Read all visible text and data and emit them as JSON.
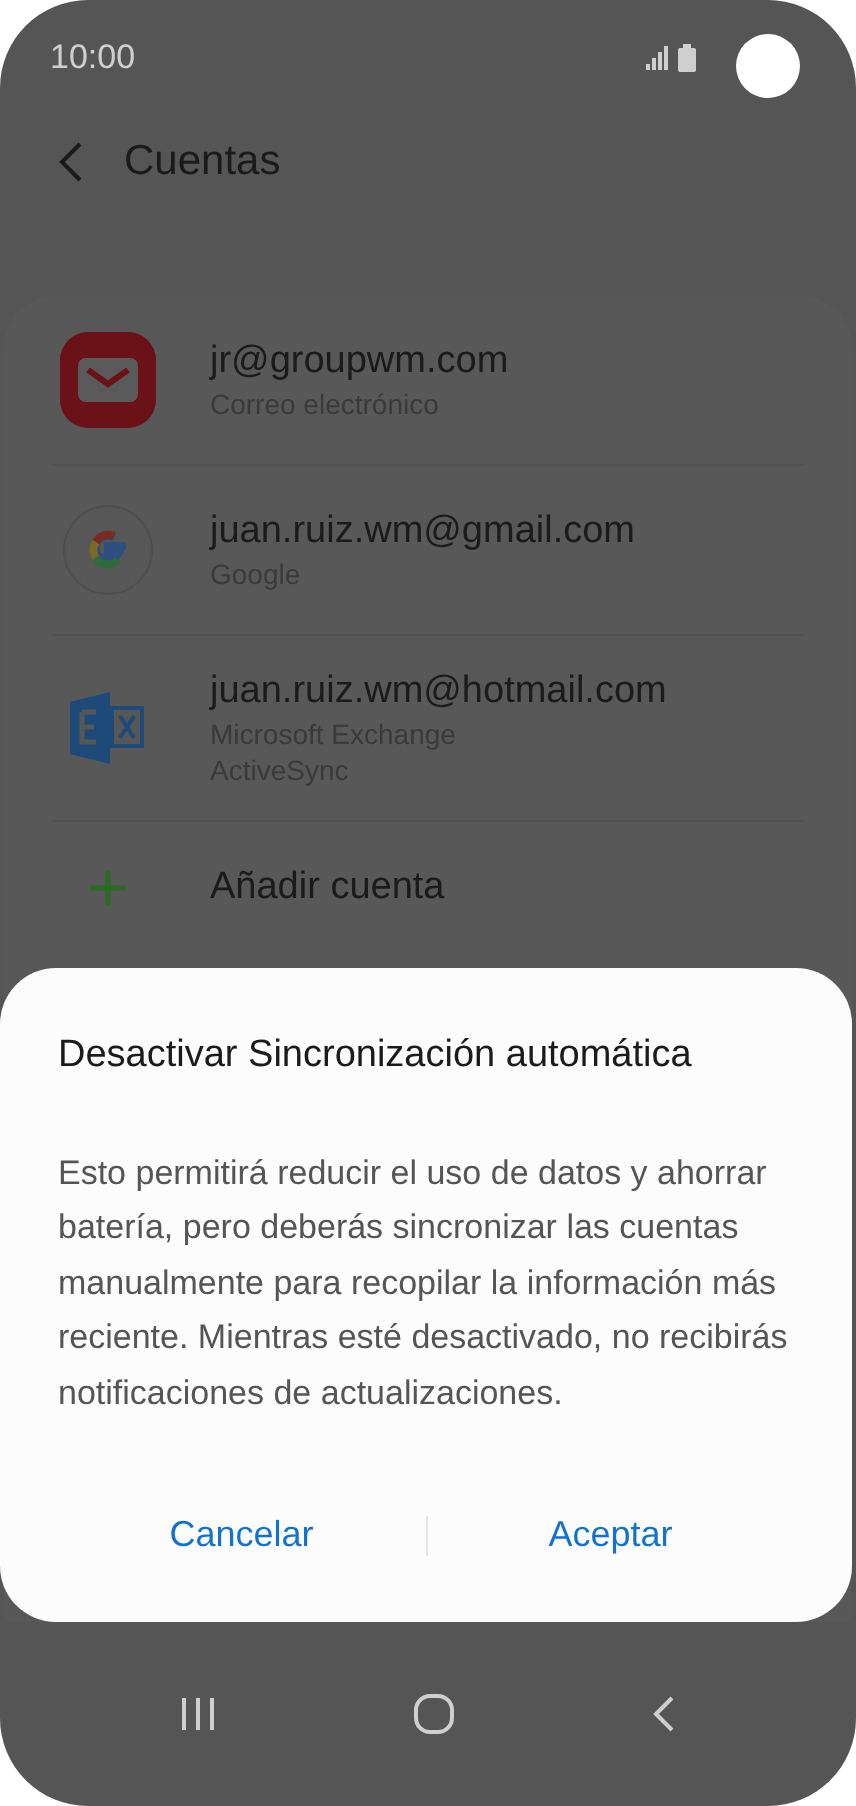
{
  "status_bar": {
    "time": "10:00"
  },
  "header": {
    "title": "Cuentas"
  },
  "accounts": [
    {
      "kind": "mail",
      "name": "jr@groupwm.com",
      "type_lines": [
        "Correo electrónico"
      ]
    },
    {
      "kind": "google",
      "name": "juan.ruiz.wm@gmail.com",
      "type_lines": [
        "Google"
      ]
    },
    {
      "kind": "exchange",
      "name": "juan.ruiz.wm@hotmail.com",
      "type_lines": [
        "Microsoft Exchange",
        "ActiveSync"
      ]
    }
  ],
  "add_account": {
    "label": "Añadir cuenta"
  },
  "dialog": {
    "title": "Desactivar Sincronización automática",
    "message": "Esto permitirá reducir el uso de datos y ahorrar batería, pero deberás sincronizar las cuentas manualmente para recopilar la información más reciente. Mientras esté desactivado, no recibirás notificaciones de actualizaciones.",
    "buttons": [
      "Cancelar",
      "Aceptar"
    ]
  }
}
